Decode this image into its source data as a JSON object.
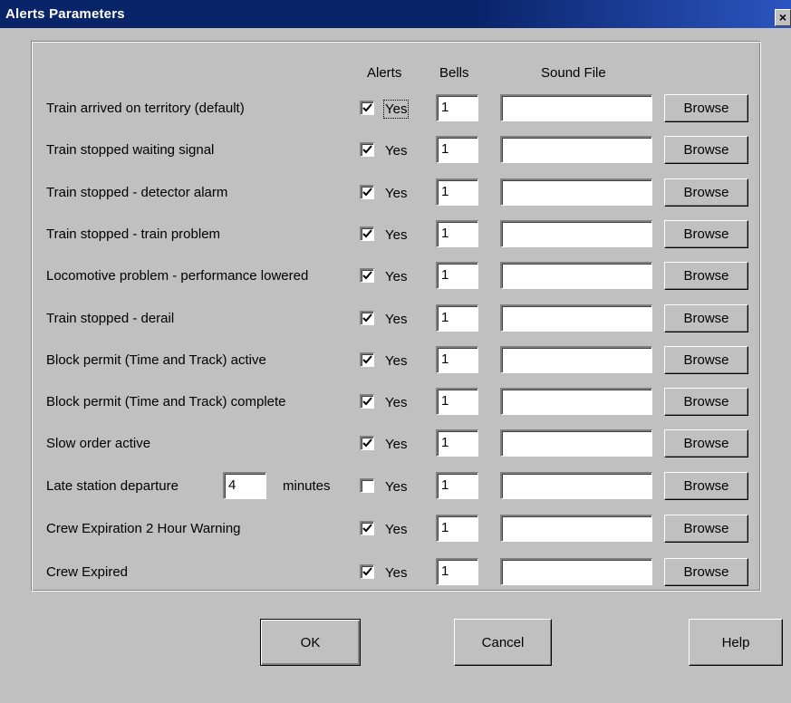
{
  "window": {
    "title": "Alerts Parameters",
    "close_glyph": "×"
  },
  "headers": {
    "alerts": "Alerts",
    "bells": "Bells",
    "sound_file": "Sound File"
  },
  "rows": [
    {
      "label": "Train arrived on territory (default)",
      "checked": true,
      "yes": "Yes",
      "bells": "1",
      "sound_file": "",
      "browse": "Browse"
    },
    {
      "label": "Train stopped waiting signal",
      "checked": true,
      "yes": "Yes",
      "bells": "1",
      "sound_file": "",
      "browse": "Browse"
    },
    {
      "label": "Train stopped - detector alarm",
      "checked": true,
      "yes": "Yes",
      "bells": "1",
      "sound_file": "",
      "browse": "Browse"
    },
    {
      "label": "Train stopped - train problem",
      "checked": true,
      "yes": "Yes",
      "bells": "1",
      "sound_file": "",
      "browse": "Browse"
    },
    {
      "label": "Locomotive problem - performance lowered",
      "checked": true,
      "yes": "Yes",
      "bells": "1",
      "sound_file": "",
      "browse": "Browse"
    },
    {
      "label": "Train stopped - derail",
      "checked": true,
      "yes": "Yes",
      "bells": "1",
      "sound_file": "",
      "browse": "Browse"
    },
    {
      "label": "Block permit (Time and Track) active",
      "checked": true,
      "yes": "Yes",
      "bells": "1",
      "sound_file": "",
      "browse": "Browse"
    },
    {
      "label": "Block permit (Time and Track) complete",
      "checked": true,
      "yes": "Yes",
      "bells": "1",
      "sound_file": "",
      "browse": "Browse"
    },
    {
      "label": "Slow order active",
      "checked": true,
      "yes": "Yes",
      "bells": "1",
      "sound_file": "",
      "browse": "Browse"
    },
    {
      "label": "Late station departure",
      "minutes_value": "4",
      "minutes_label": "minutes",
      "checked": false,
      "yes": "Yes",
      "bells": "1",
      "sound_file": "",
      "browse": "Browse"
    },
    {
      "label": "Crew Expiration 2 Hour Warning",
      "checked": true,
      "yes": "Yes",
      "bells": "1",
      "sound_file": "",
      "browse": "Browse"
    },
    {
      "label": "Crew Expired",
      "checked": true,
      "yes": "Yes",
      "bells": "1",
      "sound_file": "",
      "browse": "Browse"
    }
  ],
  "buttons": {
    "ok": "OK",
    "cancel": "Cancel",
    "help": "Help"
  }
}
